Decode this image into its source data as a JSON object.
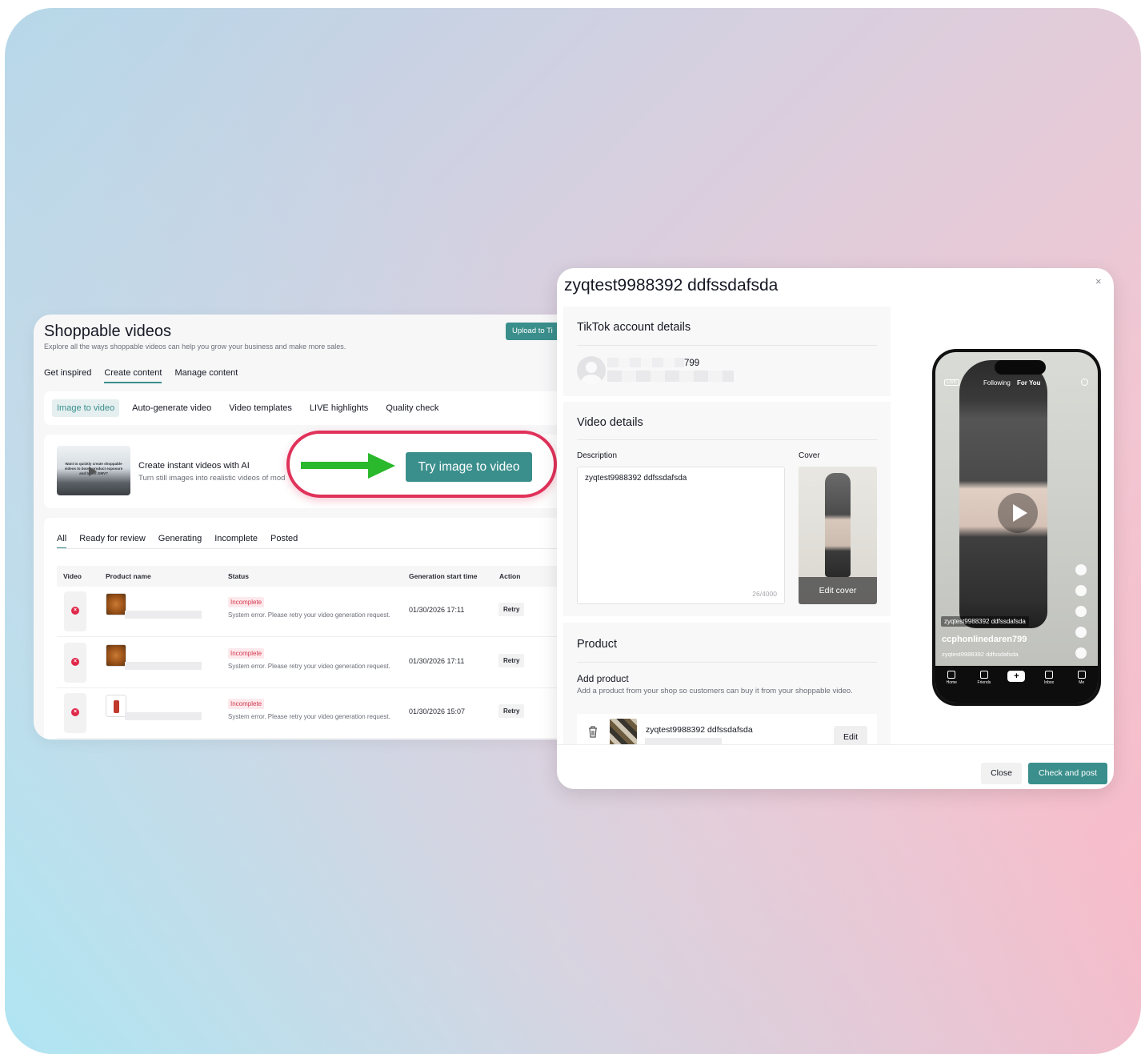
{
  "left_panel": {
    "title": "Shoppable videos",
    "subtitle": "Explore all the ways shoppable videos can help you grow your business and make more sales.",
    "upload_button": "Upload to Ti",
    "top_tabs": [
      "Get inspired",
      "Create content",
      "Manage content"
    ],
    "active_top_tab": "Create content",
    "sub_tabs": [
      "Image to video",
      "Auto-generate video",
      "Video templates",
      "LIVE highlights",
      "Quality check"
    ],
    "active_sub_tab": "Image to video",
    "promo": {
      "thumb_text": "Want to quickly create shoppable videos to boost product exposure and boost GMV?",
      "title": "Create instant videos with AI",
      "subtitle": "Turn still images into realistic videos of mod",
      "cta": "Try image to video"
    },
    "status_tabs": [
      "All",
      "Ready for review",
      "Generating",
      "Incomplete",
      "Posted"
    ],
    "active_status_tab": "All",
    "table": {
      "columns": [
        "Video",
        "Product name",
        "Status",
        "Generation start time",
        "Action"
      ],
      "rows": [
        {
          "status": "Incomplete",
          "message": "System error. Please retry your video generation request.",
          "time": "01/30/2026 17:11",
          "action": "Retry",
          "thumb": "food"
        },
        {
          "status": "Incomplete",
          "message": "System error. Please retry your video generation request.",
          "time": "01/30/2026 17:11",
          "action": "Retry",
          "thumb": "food"
        },
        {
          "status": "Incomplete",
          "message": "System error. Please retry your video generation request.",
          "time": "01/30/2026 15:07",
          "action": "Retry",
          "thumb": "radio"
        }
      ]
    }
  },
  "modal": {
    "title": "zyqtest9988392 ddfssdafsda",
    "close_glyph": "×",
    "account_section": {
      "title": "TikTok account details",
      "name_suffix": "799"
    },
    "video_section": {
      "title": "Video details",
      "description_label": "Description",
      "description_value": "zyqtest9988392 ddfssdafsda",
      "char_count": "26/4000",
      "cover_label": "Cover",
      "edit_cover": "Edit cover"
    },
    "product_section": {
      "title": "Product",
      "add_title": "Add product",
      "add_subtitle": "Add a product from your shop so customers can buy it from your shoppable video.",
      "product_name": "zyqtest9988392 ddfssdafsda",
      "edit_button": "Edit"
    },
    "phone_preview": {
      "live": "LIVE",
      "following": "Following",
      "for_you": "For You",
      "product_tag": "zyqtest9988392 ddfssdafsda",
      "username": "ccphonlinedaren799",
      "caption": "zyqtest9988392 ddfssdafsda",
      "nav": [
        "Home",
        "Friends",
        "+",
        "Inbox",
        "Me"
      ]
    },
    "footer": {
      "close": "Close",
      "post": "Check and post"
    }
  },
  "colors": {
    "accent": "#3a8f8c",
    "highlight_ring": "#e0325a",
    "arrow": "#2ab82c",
    "error": "#e0294a"
  }
}
